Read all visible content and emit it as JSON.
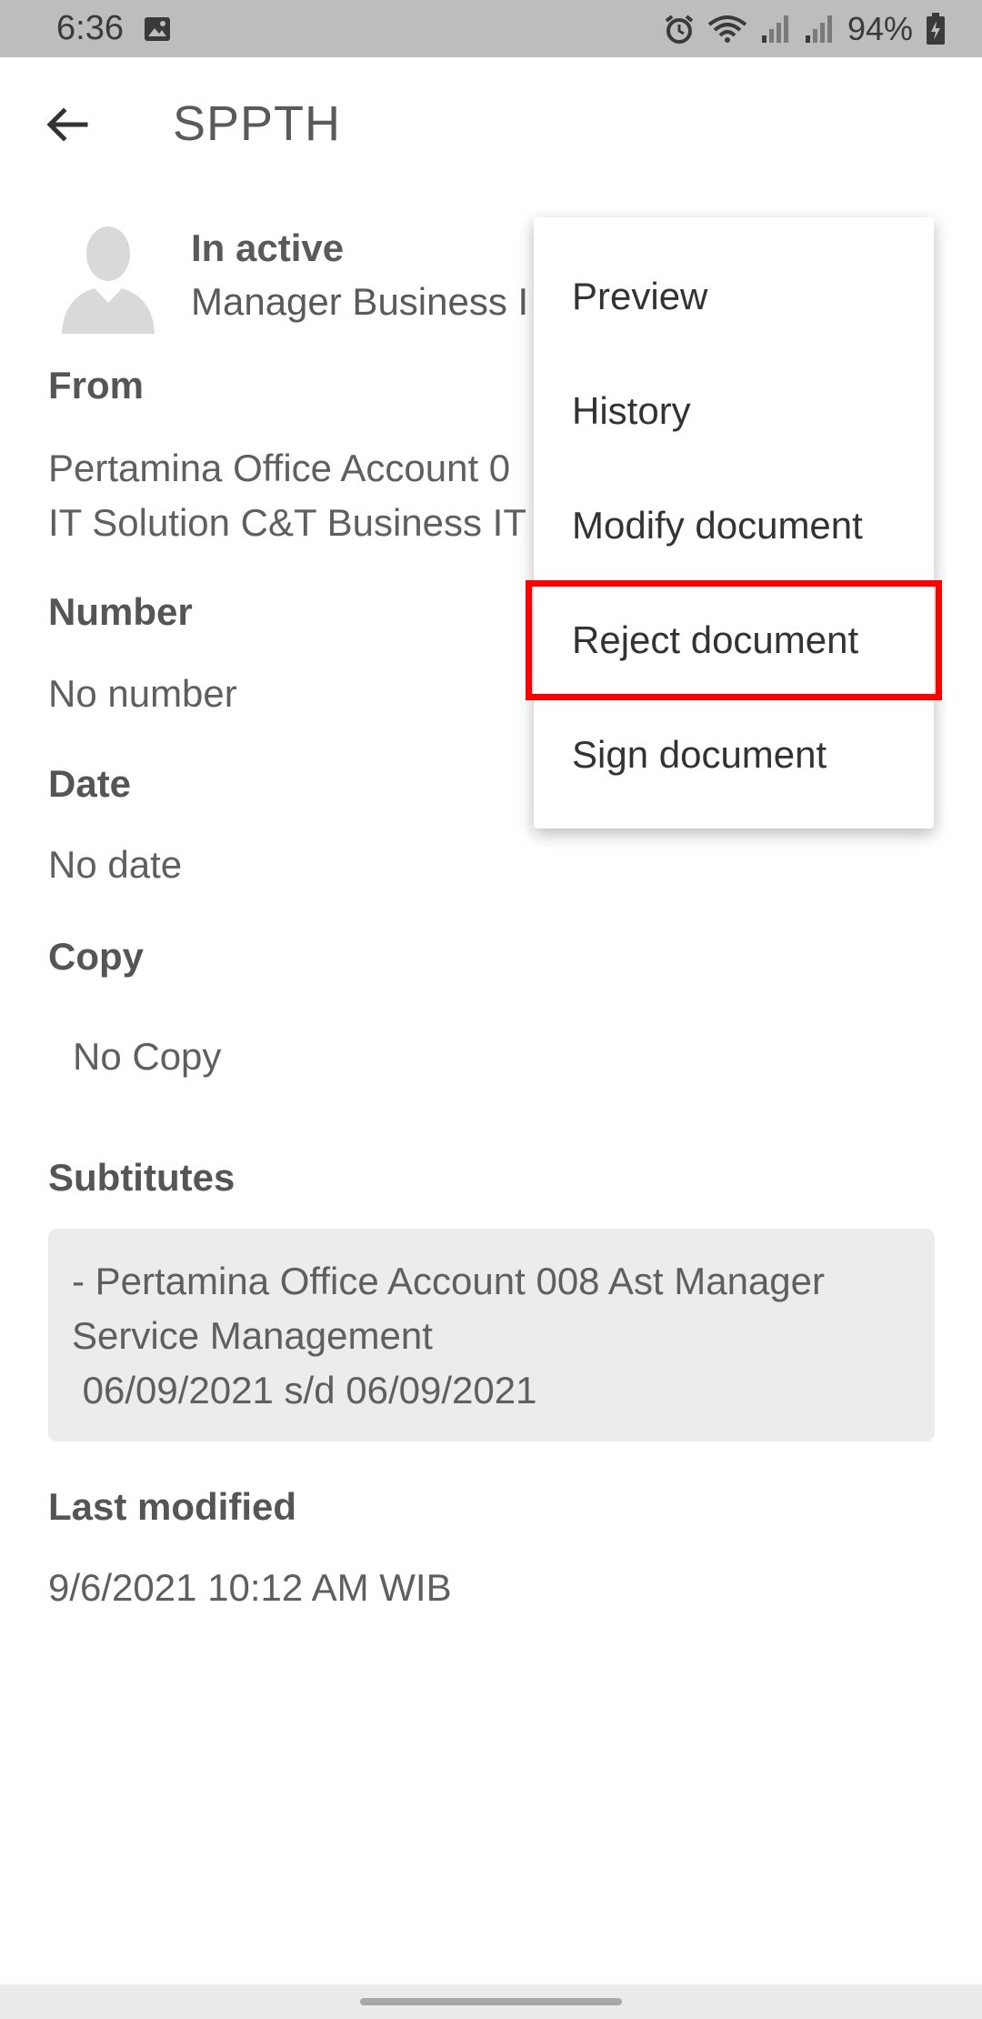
{
  "status_bar": {
    "time": "6:36",
    "battery": "94%"
  },
  "app_bar": {
    "title": "SPPTH"
  },
  "profile": {
    "status": "In active",
    "position": "Manager Business I"
  },
  "from": {
    "heading": "From",
    "line1": "Pertamina Office Account 0",
    "line2": "IT Solution C&T Business IT"
  },
  "number": {
    "heading": "Number",
    "value": "No number"
  },
  "date": {
    "heading": "Date",
    "value": "No date"
  },
  "copy": {
    "heading": "Copy",
    "value": "No Copy"
  },
  "substitutes": {
    "heading": "Subtitutes",
    "line1": "- Pertamina Office Account 008 Ast Manager",
    "line2": "Service Management",
    "line3": " 06/09/2021 s/d 06/09/2021"
  },
  "last_modified": {
    "heading": "Last modified",
    "value": "9/6/2021 10:12 AM WIB"
  },
  "menu": {
    "items": [
      {
        "label": "Preview"
      },
      {
        "label": "History"
      },
      {
        "label": "Modify document"
      },
      {
        "label": "Reject document"
      },
      {
        "label": "Sign document"
      }
    ],
    "highlight_color": "#ff0000"
  },
  "icons": {
    "back": "arrow-left-icon",
    "avatar": "person-silhouette-icon",
    "status_image": "image-icon",
    "alarm": "alarm-icon",
    "wifi": "wifi-icon",
    "signal": "signal-icon",
    "battery": "battery-charging-icon"
  }
}
